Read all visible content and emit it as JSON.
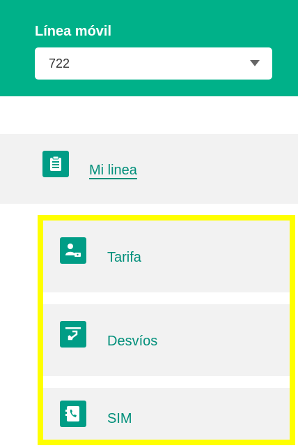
{
  "header": {
    "title": "Línea móvil",
    "select_value": "722"
  },
  "nav": {
    "main_label": "Mi linea",
    "sub_items": [
      {
        "label": "Tarifa"
      },
      {
        "label": "Desvíos"
      },
      {
        "label": "SIM"
      }
    ]
  },
  "colors": {
    "brand_green": "#00b189",
    "icon_green": "#009d86",
    "text_green": "#008f7a",
    "highlight": "#ffff00"
  }
}
